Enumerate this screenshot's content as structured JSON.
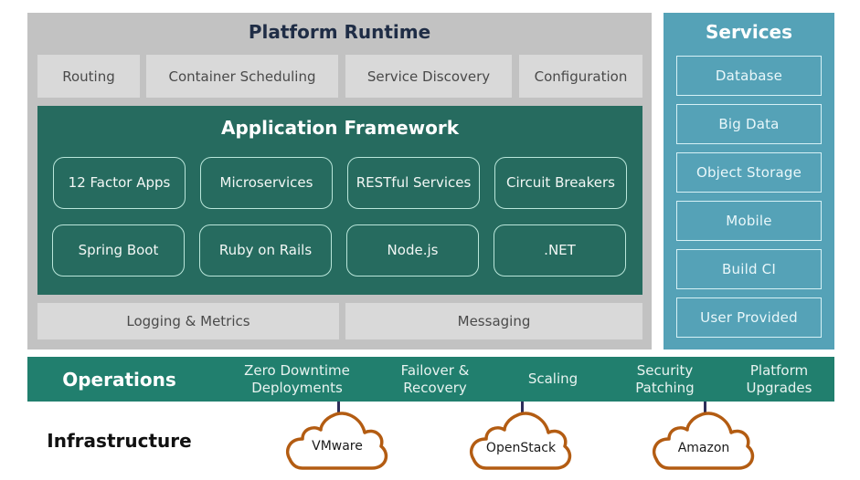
{
  "platform_runtime": {
    "title": "Platform Runtime",
    "top_row": [
      "Routing",
      "Container Scheduling",
      "Service Discovery",
      "Configuration"
    ],
    "bottom_row": [
      "Logging & Metrics",
      "Messaging"
    ]
  },
  "application_framework": {
    "title": "Application Framework",
    "row1": [
      "12 Factor Apps",
      "Microservices",
      "RESTful Services",
      "Circuit Breakers"
    ],
    "row2": [
      "Spring Boot",
      "Ruby on Rails",
      "Node.js",
      ".NET"
    ]
  },
  "services": {
    "title": "Services",
    "items": [
      "Database",
      "Big Data",
      "Object Storage",
      "Mobile",
      "Build CI",
      "User Provided"
    ]
  },
  "operations": {
    "title": "Operations",
    "items": [
      "Zero Downtime Deployments",
      "Failover & Recovery",
      "Scaling",
      "Security Patching",
      "Platform Upgrades"
    ]
  },
  "infrastructure": {
    "title": "Infrastructure",
    "clouds": [
      "VMware",
      "OpenStack",
      "Amazon"
    ]
  },
  "colors": {
    "runtime_bg": "#c2c2c2",
    "tile_bg": "#d9d9d9",
    "framework_bg": "#266b5f",
    "services_bg": "#55a2b7",
    "operations_bg": "#217f6e",
    "cloud_stroke": "#b35c12",
    "connector": "#2d2e5a"
  }
}
